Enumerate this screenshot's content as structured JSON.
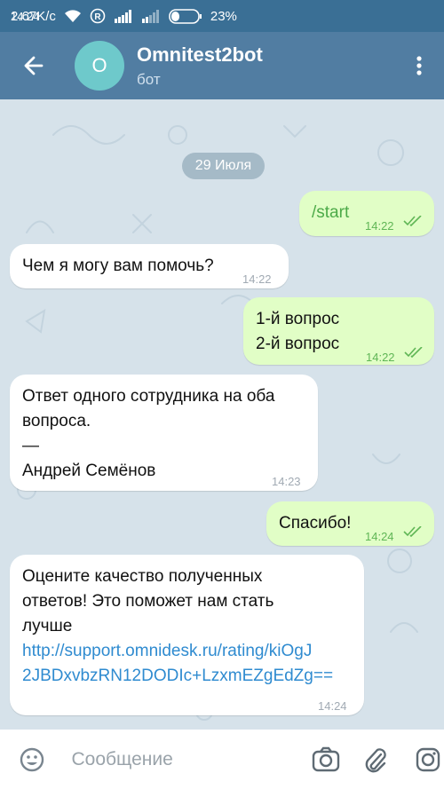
{
  "status": {
    "time": "14:24",
    "speed": "2.67K/c",
    "battery": "23%"
  },
  "header": {
    "avatar_letter": "O",
    "title": "Omnitest2bot",
    "subtitle": "бот"
  },
  "chat": {
    "date": "29 Июля",
    "messages": [
      {
        "direction": "out",
        "lines": [
          "/start"
        ],
        "time": "14:22",
        "read": true
      },
      {
        "direction": "in",
        "lines": [
          "Чем я могу вам помочь?"
        ],
        "time": "14:22"
      },
      {
        "direction": "out",
        "lines": [
          "1-й вопрос",
          "2-й вопрос"
        ],
        "time": "14:22",
        "read": true
      },
      {
        "direction": "in",
        "lines": [
          "Ответ одного сотрудника на оба",
          "вопроса.",
          "—",
          "Андрей Семёнов"
        ],
        "time": "14:23"
      },
      {
        "direction": "out",
        "lines": [
          "Спасибо!"
        ],
        "time": "14:24",
        "read": true
      },
      {
        "direction": "in",
        "lines": [
          "Оцените качество полученных",
          "ответов! Это поможет нам стать",
          "лучше"
        ],
        "link": "http://support.omnidesk.ru/rating/kiOgJ2JBDxvbzRN12DODIc+LzxmEZgEdZg==",
        "link_lines": [
          "http://support.omnidesk.ru/rating/kiOgJ",
          "2JBDxvbzRN12DODIc+LzxmEZgEdZg=="
        ],
        "time": "14:24"
      }
    ]
  },
  "composer": {
    "placeholder": "Сообщение"
  },
  "colors": {
    "status_bar": "#3a6f95",
    "header": "#517da2",
    "avatar": "#6ec9cb",
    "chat_bg": "#d6e2ea",
    "outgoing_bubble": "#e1fec6",
    "incoming_bubble": "#ffffff",
    "link": "#2f8bd0",
    "read_ticks": "#5fb655"
  },
  "icons": [
    "back-arrow-icon",
    "more-vert-icon",
    "emoji-icon",
    "camera-icon",
    "attach-icon",
    "instagram-icon",
    "wifi-icon",
    "registered-icon",
    "signal-icon",
    "battery-icon",
    "double-check-icon"
  ]
}
